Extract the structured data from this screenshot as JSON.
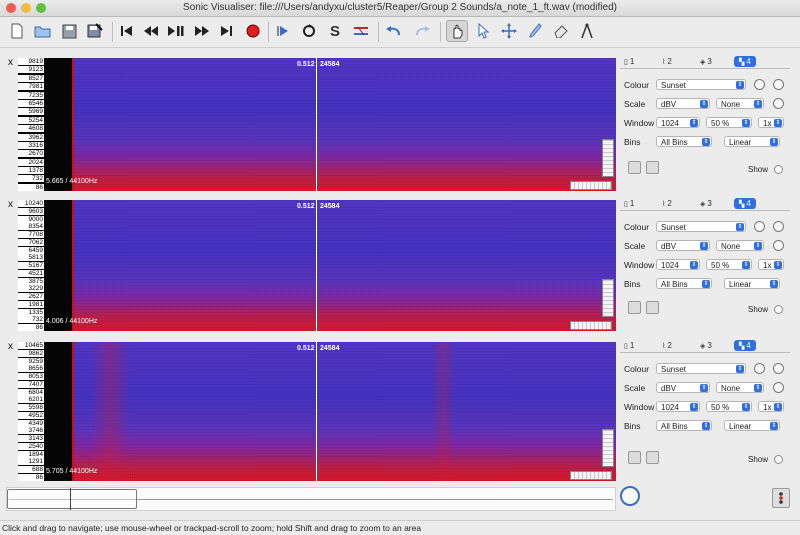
{
  "window": {
    "title": "Sonic Visualiser: file:///Users/andyxu/cluster5/Reaper/Group 2 Sounds/a_note_1_ft.wav (modified)"
  },
  "toolbar": {
    "icons": [
      "new-file-icon",
      "open-file-icon",
      "save-icon",
      "save-as-icon",
      "rewind-start-icon",
      "rewind-icon",
      "play-pause-icon",
      "fast-forward-icon",
      "forward-end-icon",
      "record-icon",
      "play-selection-icon",
      "loop-icon",
      "solo-icon",
      "align-icon",
      "undo-icon",
      "redo-icon",
      "navigate-icon",
      "select-icon",
      "move-icon",
      "draw-icon",
      "erase-icon",
      "measure-icon"
    ]
  },
  "panes": [
    {
      "close": "x",
      "scale_labels": [
        "9819",
        "9123",
        "8527",
        "7981",
        "7235",
        "6546",
        "5969",
        "5254",
        "4608",
        "3962",
        "3316",
        "2670",
        "2024",
        "1378",
        "732",
        "86"
      ],
      "center_time": "0.512",
      "center_frame": "24584",
      "sample_info": "5.665 / 44100Hz",
      "props": {
        "tabs": [
          "1",
          "2",
          "3",
          "4"
        ],
        "colour_label": "Colour",
        "colour_value": "Sunset",
        "scale_label": "Scale",
        "scale_value": "dBV",
        "scale_norm": "None",
        "window_label": "Window",
        "window_size": "1024",
        "window_overlap": "50 %",
        "window_zoom": "1x",
        "bins_label": "Bins",
        "bins_value": "All Bins",
        "bins_scale": "Linear",
        "show_label": "Show"
      }
    },
    {
      "close": "x",
      "scale_labels": [
        "10240",
        "9603",
        "9000",
        "8354",
        "7708",
        "7062",
        "6459",
        "5813",
        "5167",
        "4521",
        "3875",
        "3229",
        "2627",
        "1981",
        "1335",
        "732",
        "86"
      ],
      "center_time": "0.512",
      "center_frame": "24584",
      "sample_info": "4.006 / 44100Hz",
      "props": {
        "tabs": [
          "1",
          "2",
          "3",
          "4"
        ],
        "colour_label": "Colour",
        "colour_value": "Sunset",
        "scale_label": "Scale",
        "scale_value": "dBV",
        "scale_norm": "None",
        "window_label": "Window",
        "window_size": "1024",
        "window_overlap": "50 %",
        "window_zoom": "1x",
        "bins_label": "Bins",
        "bins_value": "All Bins",
        "bins_scale": "Linear",
        "show_label": "Show"
      }
    },
    {
      "close": "x",
      "scale_labels": [
        "10465",
        "9862",
        "9259",
        "8656",
        "8053",
        "7407",
        "6804",
        "6201",
        "5598",
        "4952",
        "4349",
        "3746",
        "3143",
        "2540",
        "1894",
        "1291",
        "688",
        "86"
      ],
      "center_time": "0.512",
      "center_frame": "24584",
      "sample_info": "5.705 / 44100Hz",
      "props": {
        "tabs": [
          "1",
          "2",
          "3",
          "4"
        ],
        "colour_label": "Colour",
        "colour_value": "Sunset",
        "scale_label": "Scale",
        "scale_value": "dBV",
        "scale_norm": "None",
        "window_label": "Window",
        "window_size": "1024",
        "window_overlap": "50 %",
        "window_zoom": "1x",
        "bins_label": "Bins",
        "bins_value": "All Bins",
        "bins_scale": "Linear",
        "show_label": "Show"
      }
    }
  ],
  "status": {
    "message": "Click and drag to navigate; use mouse-wheel or trackpad-scroll to zoom; hold Shift and drag to zoom to an area"
  },
  "colors": {
    "accent": "#2f6fe0",
    "record": "#e02020",
    "spectrogram_blue": "#4a3ac8",
    "spectrogram_red": "#e01820"
  }
}
